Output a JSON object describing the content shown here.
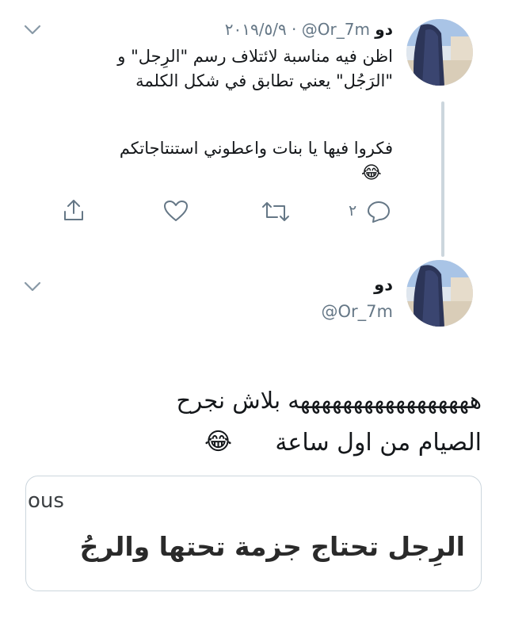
{
  "parent_tweet": {
    "name": "دو",
    "handle": "@Or_7m",
    "date": "٢٠١٩/٥/٩",
    "separator": "·",
    "text_line1": "اظن فيه مناسبة لائتلاف رسم \"الرِجل\" و",
    "text_line2": "\"الرَجُل\" يعني تطابق في شكل الكلمة",
    "text_line3": "فكروا فيها يا بنات واعطوني استنتاجاتكم",
    "emoji": "😂",
    "reply_count": "٢"
  },
  "main_tweet": {
    "name": "دو",
    "handle": "@Or_7m",
    "text_line1": "هههههههههههههههههه بلاش نجرح",
    "text_line2": "الصيام من اول ساعة",
    "emoji": "😂"
  },
  "quote": {
    "label": "ous",
    "text": "الرِجل تحتاج جزمة تحتها والرجُ"
  }
}
